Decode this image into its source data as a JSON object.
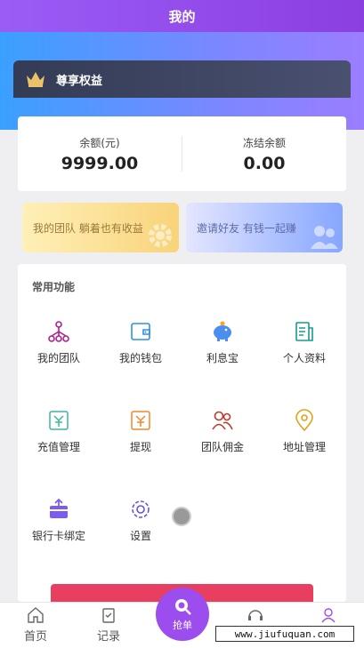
{
  "header": {
    "title": "我的"
  },
  "vip": {
    "label": "尊享权益"
  },
  "balance": {
    "left_label": "余额(元)",
    "left_value": "9999.00",
    "right_label": "冻结余额",
    "right_value": "0.00"
  },
  "promos": {
    "team": "我的团队 躺着也有收益",
    "invite": "邀请好友 有钱一起赚"
  },
  "functions": {
    "title": "常用功能",
    "items": [
      {
        "label": "我的团队",
        "icon": "team-tree-icon"
      },
      {
        "label": "我的钱包",
        "icon": "wallet-icon"
      },
      {
        "label": "利息宝",
        "icon": "piggy-bank-icon"
      },
      {
        "label": "个人资料",
        "icon": "profile-doc-icon"
      },
      {
        "label": "充值管理",
        "icon": "recharge-icon"
      },
      {
        "label": "提现",
        "icon": "withdraw-icon"
      },
      {
        "label": "团队佣金",
        "icon": "team-commission-icon"
      },
      {
        "label": "地址管理",
        "icon": "location-pin-icon"
      },
      {
        "label": "银行卡绑定",
        "icon": "bank-card-icon"
      },
      {
        "label": "设置",
        "icon": "gear-icon"
      }
    ]
  },
  "tabbar": {
    "home": "首页",
    "records": "记录",
    "center": "抢单",
    "service": "",
    "mine": ""
  },
  "watermark": "www.jiufuquan.com",
  "colors": {
    "accent": "#9b4dee",
    "red": "#e83f61"
  }
}
